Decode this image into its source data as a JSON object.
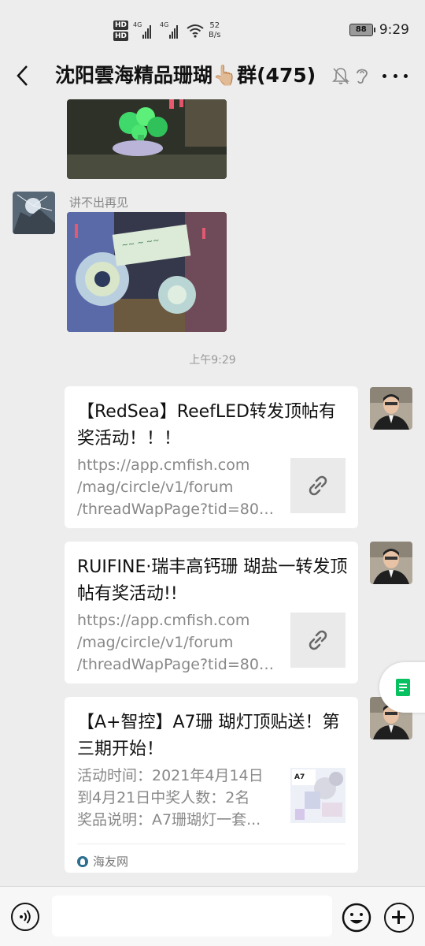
{
  "status_bar": {
    "hd1": "HD",
    "hd2": "HD",
    "signal1_label": "4G",
    "signal2_label": "4G",
    "speed_value": "52",
    "speed_unit": "B/s",
    "battery": "88",
    "time": "9:29"
  },
  "header": {
    "title": "沈阳雲海精品珊瑚👆🏼群(475)"
  },
  "messages": {
    "sender_name": "讲不出再见",
    "time_separator": "上午9:29"
  },
  "cards": [
    {
      "title": "【RedSea】ReefLED转发顶帖有奖活动！！！",
      "desc": [
        "https://app.cmfish.com",
        "/mag/circle/v1/forum",
        "/threadWapPage?tid=800..."
      ],
      "thumb_icon": "link-icon"
    },
    {
      "title": "RUIFINE·瑞丰高钙珊 瑚盐一转发顶帖有奖活动!!",
      "desc": [
        "https://app.cmfish.com",
        "/mag/circle/v1/forum",
        "/threadWapPage?tid=803..."
      ],
      "thumb_icon": "link-icon"
    },
    {
      "title": "【A+智控】A7珊 瑚灯顶贴送！第三期开始！",
      "desc": [
        "活动时间：2021年4月14日",
        "到4月21日中奖人数：2名",
        "奖品说明：A7珊瑚灯一套..."
      ],
      "source": "海友网",
      "thumb_icon": "product-image"
    }
  ],
  "input": {
    "placeholder": ""
  },
  "colors": {
    "background": "#ededed",
    "card": "#ffffff",
    "accent_green": "#07c160"
  }
}
